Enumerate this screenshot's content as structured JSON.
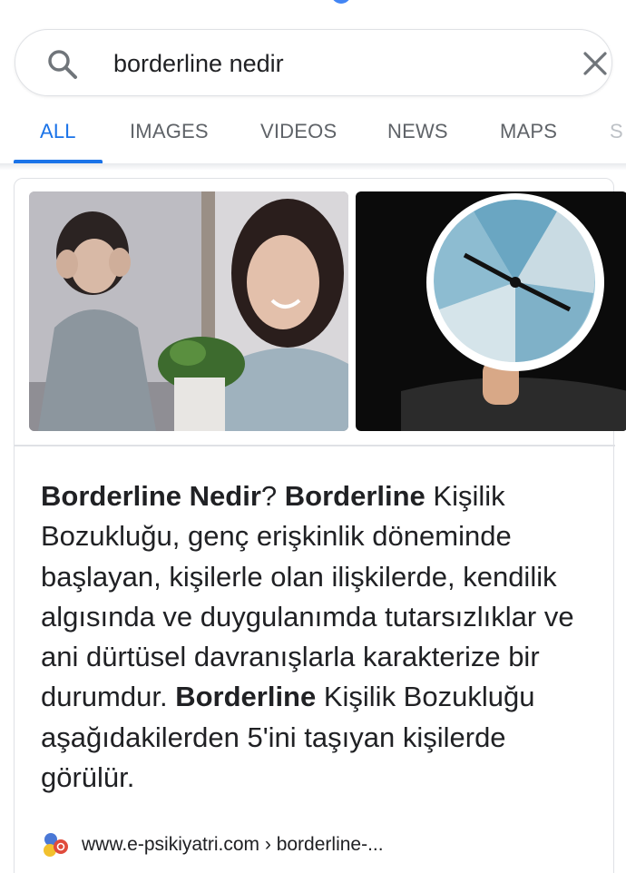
{
  "search": {
    "query": "borderline nedir"
  },
  "tabs": [
    {
      "label": "ALL",
      "active": true
    },
    {
      "label": "IMAGES",
      "active": false
    },
    {
      "label": "VIDEOS",
      "active": false
    },
    {
      "label": "NEWS",
      "active": false
    },
    {
      "label": "MAPS",
      "active": false
    },
    {
      "label": "S",
      "active": false
    }
  ],
  "result": {
    "images": [
      {
        "icon": "stock-photo-women"
      },
      {
        "icon": "clock-faces-photo"
      }
    ],
    "snippet": [
      {
        "text": "Borderline Nedir",
        "bold": true
      },
      {
        "text": "? ",
        "bold": false
      },
      {
        "text": "Borderline",
        "bold": true
      },
      {
        "text": " Kişilik Bozukluğu, genç erişkinlik döneminde başlayan, kişilerle olan ilişkilerde, kendilik algısında ve duygulanımda tutarsızlıklar ve ani dürtüsel davranışlarla karakterize bir durumdur. ",
        "bold": false
      },
      {
        "text": "Borderline",
        "bold": true
      },
      {
        "text": " Kişilik Bozukluğu aşağıdakilerden 5'ini taşıyan kişilerde görülür.",
        "bold": false
      }
    ],
    "source_url": "www.e-psikiyatri.com › borderline-..."
  },
  "colors": {
    "accent": "#1a73e8",
    "tab_inactive": "#5f6368",
    "border": "#dfe1e5"
  }
}
